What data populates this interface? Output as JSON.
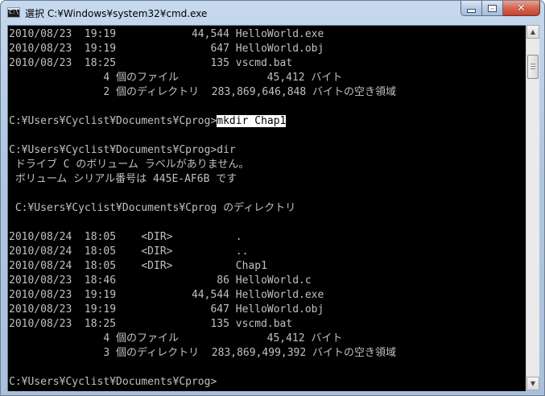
{
  "window": {
    "title": "選択 C:¥Windows¥system32¥cmd.exe",
    "icon_text": "C:\\"
  },
  "console": {
    "lines": [
      "2010/08/23  19:19            44,544 HelloWorld.exe",
      "2010/08/23  19:19               647 HelloWorld.obj",
      "2010/08/23  18:25               135 vscmd.bat",
      "               4 個のファイル              45,412 バイト",
      "               2 個のディレクトリ  283,869,646,848 バイトの空き領域",
      "",
      "C:¥Users¥Cyclist¥Documents¥Cprog>",
      "",
      "C:¥Users¥Cyclist¥Documents¥Cprog>dir",
      " ドライブ C のボリューム ラベルがありません。",
      " ボリューム シリアル番号は 445E-AF6B です",
      "",
      " C:¥Users¥Cyclist¥Documents¥Cprog のディレクトリ",
      "",
      "2010/08/24  18:05    <DIR>          .",
      "2010/08/24  18:05    <DIR>          ..",
      "2010/08/24  18:05    <DIR>          Chap1",
      "2010/08/23  18:46                86 HelloWorld.c",
      "2010/08/23  19:19            44,544 HelloWorld.exe",
      "2010/08/23  19:19               647 HelloWorld.obj",
      "2010/08/23  18:25               135 vscmd.bat",
      "               4 個のファイル              45,412 バイト",
      "               3 個のディレクトリ  283,869,499,392 バイトの空き領域",
      "",
      "C:¥Users¥Cyclist¥Documents¥Cprog>"
    ],
    "selected_text": "mkdir Chap1"
  },
  "colors": {
    "console_bg": "#000000",
    "console_fg": "#c0c0c0",
    "selection_bg": "#ffffff",
    "selection_fg": "#000000"
  }
}
